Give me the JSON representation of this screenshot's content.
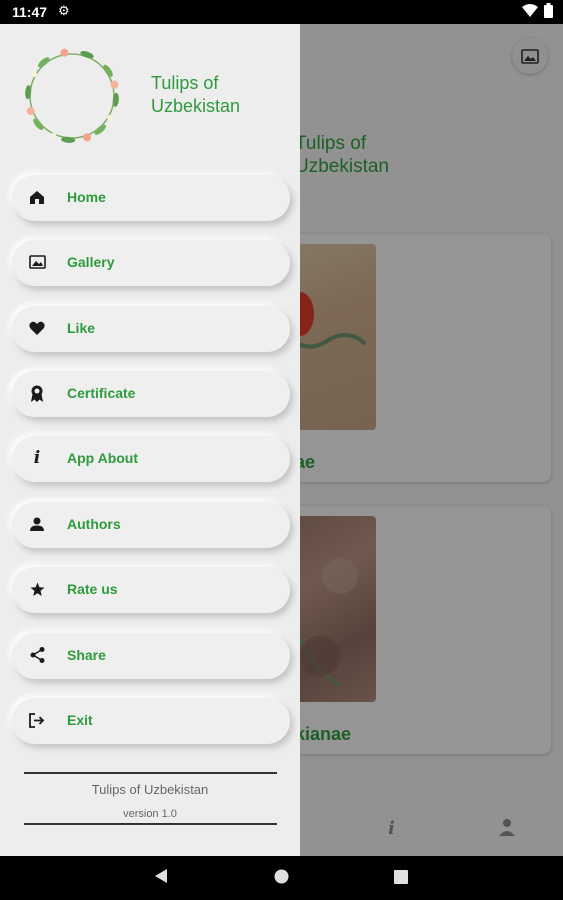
{
  "status_bar": {
    "time": "11:47"
  },
  "background": {
    "title": "Tulips of\nUzbekistan",
    "cards": [
      {
        "label": "ae"
      },
      {
        "label": "kianae"
      }
    ]
  },
  "drawer": {
    "app_title": "Tulips of\nUzbekistan",
    "menu": [
      {
        "label": "Home",
        "icon": "home-icon"
      },
      {
        "label": "Gallery",
        "icon": "gallery-icon"
      },
      {
        "label": "Like",
        "icon": "heart-icon"
      },
      {
        "label": "Certificate",
        "icon": "certificate-icon"
      },
      {
        "label": "App About",
        "icon": "info-icon"
      },
      {
        "label": "Authors",
        "icon": "person-icon"
      },
      {
        "label": "Rate us",
        "icon": "star-icon"
      },
      {
        "label": "Share",
        "icon": "share-icon"
      },
      {
        "label": "Exit",
        "icon": "exit-icon"
      }
    ],
    "footer": {
      "title": "Tulips of Uzbekistan",
      "version": "version 1.0"
    }
  },
  "colors": {
    "accent_green": "#2e9b3c",
    "drawer_bg": "#ededed"
  }
}
